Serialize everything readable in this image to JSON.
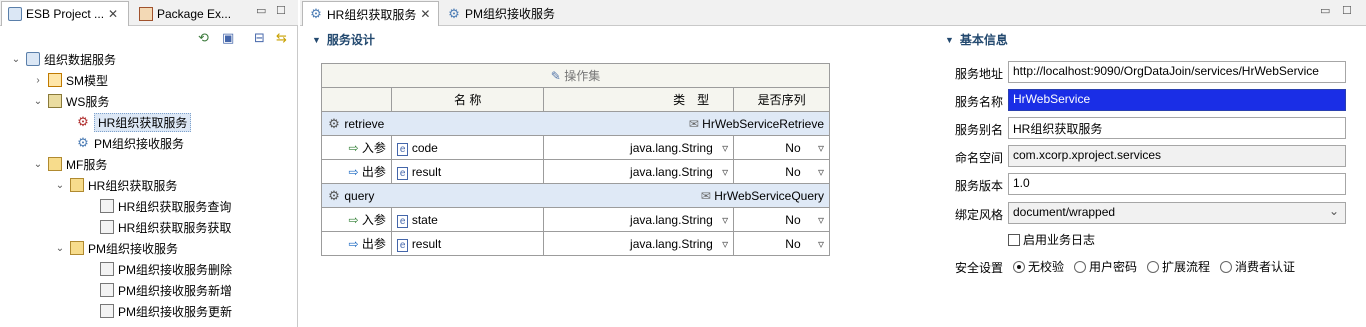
{
  "left_panel": {
    "tabs": [
      {
        "label": "ESB Project ..."
      },
      {
        "label": "Package Ex..."
      }
    ],
    "tree": [
      {
        "label": "组织数据服务"
      },
      {
        "label": "SM模型"
      },
      {
        "label": "WS服务"
      },
      {
        "label": "HR组织获取服务"
      },
      {
        "label": "PM组织接收服务"
      },
      {
        "label": "MF服务"
      },
      {
        "label": "HR组织获取服务"
      },
      {
        "label": "HR组织获取服务查询"
      },
      {
        "label": "HR组织获取服务获取"
      },
      {
        "label": "PM组织接收服务"
      },
      {
        "label": "PM组织接收服务删除"
      },
      {
        "label": "PM组织接收服务新增"
      },
      {
        "label": "PM组织接收服务更新"
      }
    ]
  },
  "editor": {
    "tabs": [
      {
        "label": "HR组织获取服务"
      },
      {
        "label": "PM组织接收服务"
      }
    ],
    "design_section": {
      "title": "服务设计",
      "toolbar_label": "操作集",
      "columns": {
        "name": "名 称",
        "type": "类　型",
        "serial": "是否序列"
      },
      "operations": [
        {
          "name": "retrieve",
          "message": "HrWebServiceRetrieve",
          "params": [
            {
              "direction": "入参",
              "name": "code",
              "type": "java.lang.String",
              "serial": "No"
            },
            {
              "direction": "出参",
              "name": "result",
              "type": "java.lang.String",
              "serial": "No"
            }
          ]
        },
        {
          "name": "query",
          "message": "HrWebServiceQuery",
          "params": [
            {
              "direction": "入参",
              "name": "state",
              "type": "java.lang.String",
              "serial": "No"
            },
            {
              "direction": "出参",
              "name": "result",
              "type": "java.lang.String",
              "serial": "No"
            }
          ]
        }
      ]
    },
    "info_section": {
      "title": "基本信息",
      "service_address_label": "服务地址",
      "service_address": "http://localhost:9090/OrgDataJoin/services/HrWebService",
      "service_name_label": "服务名称",
      "service_name": "HrWebService",
      "service_alias_label": "服务别名",
      "service_alias": "HR组织获取服务",
      "namespace_label": "命名空间",
      "namespace": "com.xcorp.xproject.services",
      "version_label": "服务版本",
      "version": "1.0",
      "binding_label": "绑定风格",
      "binding": "document/wrapped",
      "enable_log_label": "启用业务日志",
      "security_label": "安全设置",
      "security_options": [
        {
          "label": "无校验",
          "selected": true
        },
        {
          "label": "用户密码",
          "selected": false
        },
        {
          "label": "扩展流程",
          "selected": false
        },
        {
          "label": "消费者认证",
          "selected": false
        }
      ]
    }
  }
}
